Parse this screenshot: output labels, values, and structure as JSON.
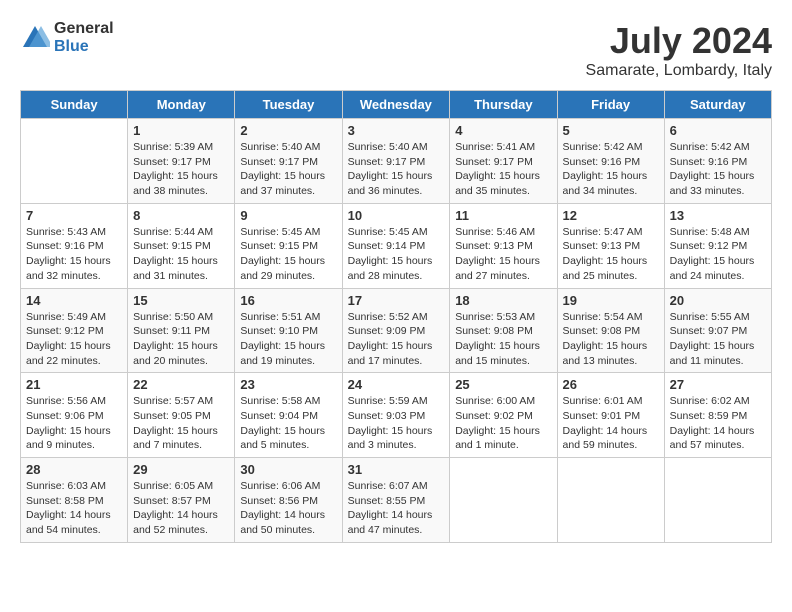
{
  "logo": {
    "line1": "General",
    "line2": "Blue"
  },
  "title": "July 2024",
  "location": "Samarate, Lombardy, Italy",
  "weekdays": [
    "Sunday",
    "Monday",
    "Tuesday",
    "Wednesday",
    "Thursday",
    "Friday",
    "Saturday"
  ],
  "weeks": [
    [
      {
        "day": "",
        "sunrise": "",
        "sunset": "",
        "daylight": ""
      },
      {
        "day": "1",
        "sunrise": "Sunrise: 5:39 AM",
        "sunset": "Sunset: 9:17 PM",
        "daylight": "Daylight: 15 hours and 38 minutes."
      },
      {
        "day": "2",
        "sunrise": "Sunrise: 5:40 AM",
        "sunset": "Sunset: 9:17 PM",
        "daylight": "Daylight: 15 hours and 37 minutes."
      },
      {
        "day": "3",
        "sunrise": "Sunrise: 5:40 AM",
        "sunset": "Sunset: 9:17 PM",
        "daylight": "Daylight: 15 hours and 36 minutes."
      },
      {
        "day": "4",
        "sunrise": "Sunrise: 5:41 AM",
        "sunset": "Sunset: 9:17 PM",
        "daylight": "Daylight: 15 hours and 35 minutes."
      },
      {
        "day": "5",
        "sunrise": "Sunrise: 5:42 AM",
        "sunset": "Sunset: 9:16 PM",
        "daylight": "Daylight: 15 hours and 34 minutes."
      },
      {
        "day": "6",
        "sunrise": "Sunrise: 5:42 AM",
        "sunset": "Sunset: 9:16 PM",
        "daylight": "Daylight: 15 hours and 33 minutes."
      }
    ],
    [
      {
        "day": "7",
        "sunrise": "Sunrise: 5:43 AM",
        "sunset": "Sunset: 9:16 PM",
        "daylight": "Daylight: 15 hours and 32 minutes."
      },
      {
        "day": "8",
        "sunrise": "Sunrise: 5:44 AM",
        "sunset": "Sunset: 9:15 PM",
        "daylight": "Daylight: 15 hours and 31 minutes."
      },
      {
        "day": "9",
        "sunrise": "Sunrise: 5:45 AM",
        "sunset": "Sunset: 9:15 PM",
        "daylight": "Daylight: 15 hours and 29 minutes."
      },
      {
        "day": "10",
        "sunrise": "Sunrise: 5:45 AM",
        "sunset": "Sunset: 9:14 PM",
        "daylight": "Daylight: 15 hours and 28 minutes."
      },
      {
        "day": "11",
        "sunrise": "Sunrise: 5:46 AM",
        "sunset": "Sunset: 9:13 PM",
        "daylight": "Daylight: 15 hours and 27 minutes."
      },
      {
        "day": "12",
        "sunrise": "Sunrise: 5:47 AM",
        "sunset": "Sunset: 9:13 PM",
        "daylight": "Daylight: 15 hours and 25 minutes."
      },
      {
        "day": "13",
        "sunrise": "Sunrise: 5:48 AM",
        "sunset": "Sunset: 9:12 PM",
        "daylight": "Daylight: 15 hours and 24 minutes."
      }
    ],
    [
      {
        "day": "14",
        "sunrise": "Sunrise: 5:49 AM",
        "sunset": "Sunset: 9:12 PM",
        "daylight": "Daylight: 15 hours and 22 minutes."
      },
      {
        "day": "15",
        "sunrise": "Sunrise: 5:50 AM",
        "sunset": "Sunset: 9:11 PM",
        "daylight": "Daylight: 15 hours and 20 minutes."
      },
      {
        "day": "16",
        "sunrise": "Sunrise: 5:51 AM",
        "sunset": "Sunset: 9:10 PM",
        "daylight": "Daylight: 15 hours and 19 minutes."
      },
      {
        "day": "17",
        "sunrise": "Sunrise: 5:52 AM",
        "sunset": "Sunset: 9:09 PM",
        "daylight": "Daylight: 15 hours and 17 minutes."
      },
      {
        "day": "18",
        "sunrise": "Sunrise: 5:53 AM",
        "sunset": "Sunset: 9:08 PM",
        "daylight": "Daylight: 15 hours and 15 minutes."
      },
      {
        "day": "19",
        "sunrise": "Sunrise: 5:54 AM",
        "sunset": "Sunset: 9:08 PM",
        "daylight": "Daylight: 15 hours and 13 minutes."
      },
      {
        "day": "20",
        "sunrise": "Sunrise: 5:55 AM",
        "sunset": "Sunset: 9:07 PM",
        "daylight": "Daylight: 15 hours and 11 minutes."
      }
    ],
    [
      {
        "day": "21",
        "sunrise": "Sunrise: 5:56 AM",
        "sunset": "Sunset: 9:06 PM",
        "daylight": "Daylight: 15 hours and 9 minutes."
      },
      {
        "day": "22",
        "sunrise": "Sunrise: 5:57 AM",
        "sunset": "Sunset: 9:05 PM",
        "daylight": "Daylight: 15 hours and 7 minutes."
      },
      {
        "day": "23",
        "sunrise": "Sunrise: 5:58 AM",
        "sunset": "Sunset: 9:04 PM",
        "daylight": "Daylight: 15 hours and 5 minutes."
      },
      {
        "day": "24",
        "sunrise": "Sunrise: 5:59 AM",
        "sunset": "Sunset: 9:03 PM",
        "daylight": "Daylight: 15 hours and 3 minutes."
      },
      {
        "day": "25",
        "sunrise": "Sunrise: 6:00 AM",
        "sunset": "Sunset: 9:02 PM",
        "daylight": "Daylight: 15 hours and 1 minute."
      },
      {
        "day": "26",
        "sunrise": "Sunrise: 6:01 AM",
        "sunset": "Sunset: 9:01 PM",
        "daylight": "Daylight: 14 hours and 59 minutes."
      },
      {
        "day": "27",
        "sunrise": "Sunrise: 6:02 AM",
        "sunset": "Sunset: 8:59 PM",
        "daylight": "Daylight: 14 hours and 57 minutes."
      }
    ],
    [
      {
        "day": "28",
        "sunrise": "Sunrise: 6:03 AM",
        "sunset": "Sunset: 8:58 PM",
        "daylight": "Daylight: 14 hours and 54 minutes."
      },
      {
        "day": "29",
        "sunrise": "Sunrise: 6:05 AM",
        "sunset": "Sunset: 8:57 PM",
        "daylight": "Daylight: 14 hours and 52 minutes."
      },
      {
        "day": "30",
        "sunrise": "Sunrise: 6:06 AM",
        "sunset": "Sunset: 8:56 PM",
        "daylight": "Daylight: 14 hours and 50 minutes."
      },
      {
        "day": "31",
        "sunrise": "Sunrise: 6:07 AM",
        "sunset": "Sunset: 8:55 PM",
        "daylight": "Daylight: 14 hours and 47 minutes."
      },
      {
        "day": "",
        "sunrise": "",
        "sunset": "",
        "daylight": ""
      },
      {
        "day": "",
        "sunrise": "",
        "sunset": "",
        "daylight": ""
      },
      {
        "day": "",
        "sunrise": "",
        "sunset": "",
        "daylight": ""
      }
    ]
  ]
}
